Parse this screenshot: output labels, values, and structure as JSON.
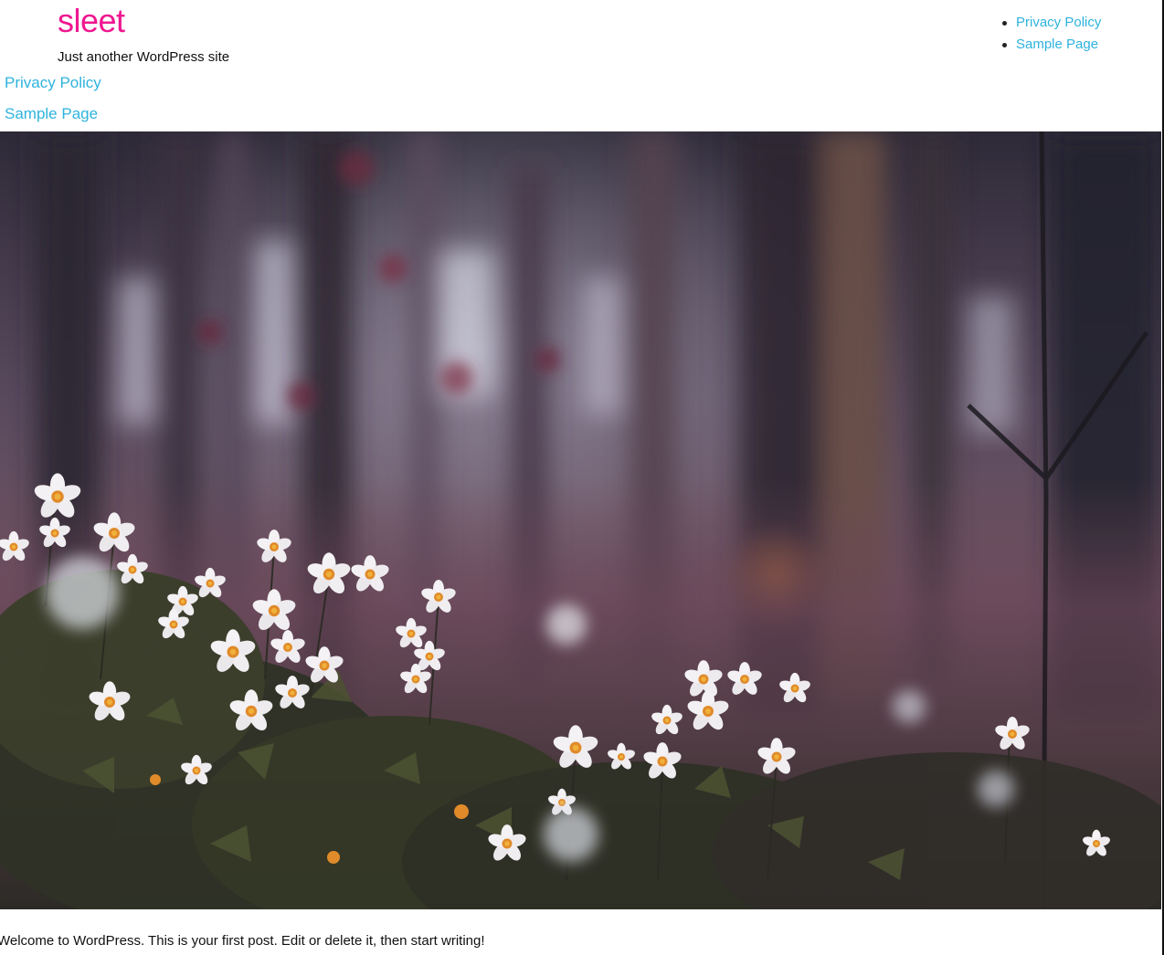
{
  "site": {
    "title": "sleet",
    "tagline": "Just another WordPress site",
    "brand_color": "#ef1790",
    "link_color": "#2eb3de"
  },
  "top_nav": {
    "items": [
      {
        "label": "Privacy Policy"
      },
      {
        "label": "Sample Page"
      }
    ]
  },
  "side_nav": {
    "items": [
      {
        "label": "Privacy Policy"
      },
      {
        "label": "Sample Page"
      }
    ]
  },
  "hero_image": {
    "subject": "white wood anemone flowers in a blurred purple forest"
  },
  "post": {
    "excerpt": "Welcome to WordPress. This is your first post. Edit or delete it, then start writing!"
  }
}
